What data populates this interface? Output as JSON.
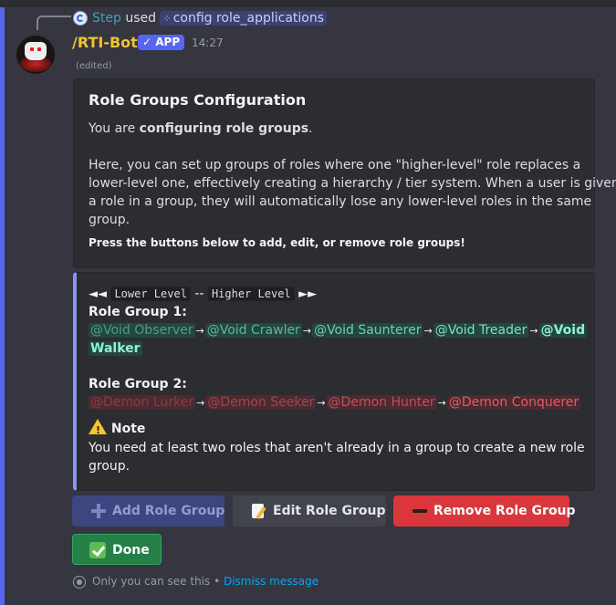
{
  "reply": {
    "user": "Step",
    "used": "used",
    "command": "config role_applications"
  },
  "author": {
    "name": "/RTI-Bot",
    "badge": "APP",
    "badge_check": "✓",
    "time": "14:27",
    "edited": "(edited)"
  },
  "embed1": {
    "title": "Role Groups Configuration",
    "line1_pre": "You are ",
    "line1_bold": "configuring role groups",
    "line1_post": ".",
    "para": [
      "Here, you can set up groups of roles where one \"higher-level\" role replaces a",
      "lower-level one, effectively creating a hierarchy / tier system. When a user is given",
      "a role in a group, they will automatically lose any lower-level roles in the same",
      "group."
    ],
    "small": "Press the buttons below to add, edit, or remove role groups!"
  },
  "embed2": {
    "left_arrows": "◄◄",
    "lower": "Lower Level",
    "sep": "--",
    "higher": "Higher Level",
    "right_arrows": "►►",
    "group1_label": "Role Group 1",
    "group1_roles": [
      "@Void Observer",
      "@Void Crawler",
      "@Void Saunterer",
      "@Void Treader",
      "@Void",
      "Walker"
    ],
    "group2_label": "Role Group 2",
    "group2_roles": [
      "@Demon Lurker",
      "@Demon Seeker",
      "@Demon Hunter",
      "@Demon Conquerer"
    ],
    "note_title": "Note",
    "note_text_1": "You need at least two roles that aren't already in a group to create a new role",
    "note_text_2": "group.",
    "colon": ":"
  },
  "buttons": {
    "add": "Add Role Group",
    "edit": "Edit Role Group",
    "remove": "Remove Role Group",
    "done": "Done"
  },
  "footer": {
    "text": "Only you can see this • ",
    "dismiss": "Dismiss message"
  },
  "colors": {
    "accent": "#5865f2",
    "author": "#f0c330",
    "void_roles": "#7fe0c5",
    "demon_roles": "#e05b66",
    "remove": "#da373c",
    "done": "#248046"
  }
}
